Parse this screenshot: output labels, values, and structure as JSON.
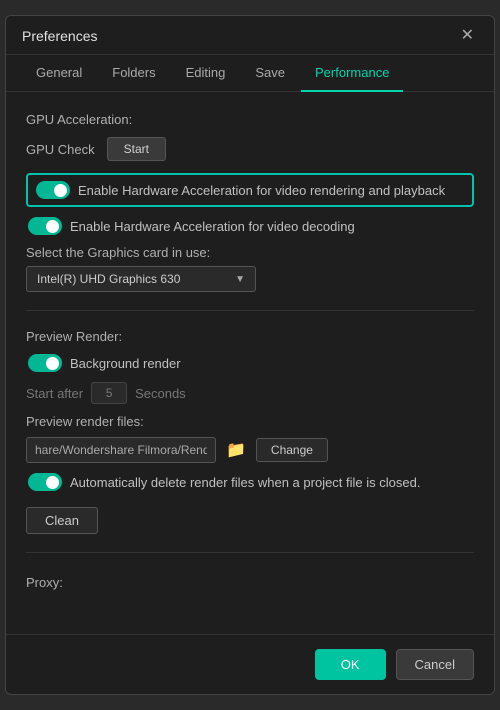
{
  "dialog": {
    "title": "Preferences",
    "close_label": "✕"
  },
  "tabs": [
    {
      "label": "General",
      "active": false
    },
    {
      "label": "Folders",
      "active": false
    },
    {
      "label": "Editing",
      "active": false
    },
    {
      "label": "Save",
      "active": false
    },
    {
      "label": "Performance",
      "active": true
    }
  ],
  "gpu_acceleration": {
    "section_label": "GPU Acceleration:",
    "gpu_check_label": "GPU Check",
    "start_button_label": "Start",
    "hw_accel_video_label": "Enable Hardware Acceleration for video rendering and playback",
    "hw_accel_decode_label": "Enable Hardware Acceleration for video decoding",
    "graphics_card_label": "Select the Graphics card in use:",
    "graphics_card_value": "Intel(R) UHD Graphics 630",
    "toggle_video_on": true,
    "toggle_decode_on": true
  },
  "preview_render": {
    "section_label": "Preview Render:",
    "background_render_label": "Background render",
    "toggle_bg_on": true,
    "start_after_label": "Start after",
    "start_after_value": "5",
    "seconds_label": "Seconds",
    "files_label": "Preview render files:",
    "file_path_value": "hare/Wondershare Filmora/Render",
    "change_button_label": "Change",
    "auto_delete_label": "Automatically delete render files when a project file is closed.",
    "toggle_auto_delete_on": true,
    "clean_button_label": "Clean"
  },
  "proxy": {
    "section_label": "Proxy:"
  },
  "footer": {
    "ok_label": "OK",
    "cancel_label": "Cancel"
  }
}
